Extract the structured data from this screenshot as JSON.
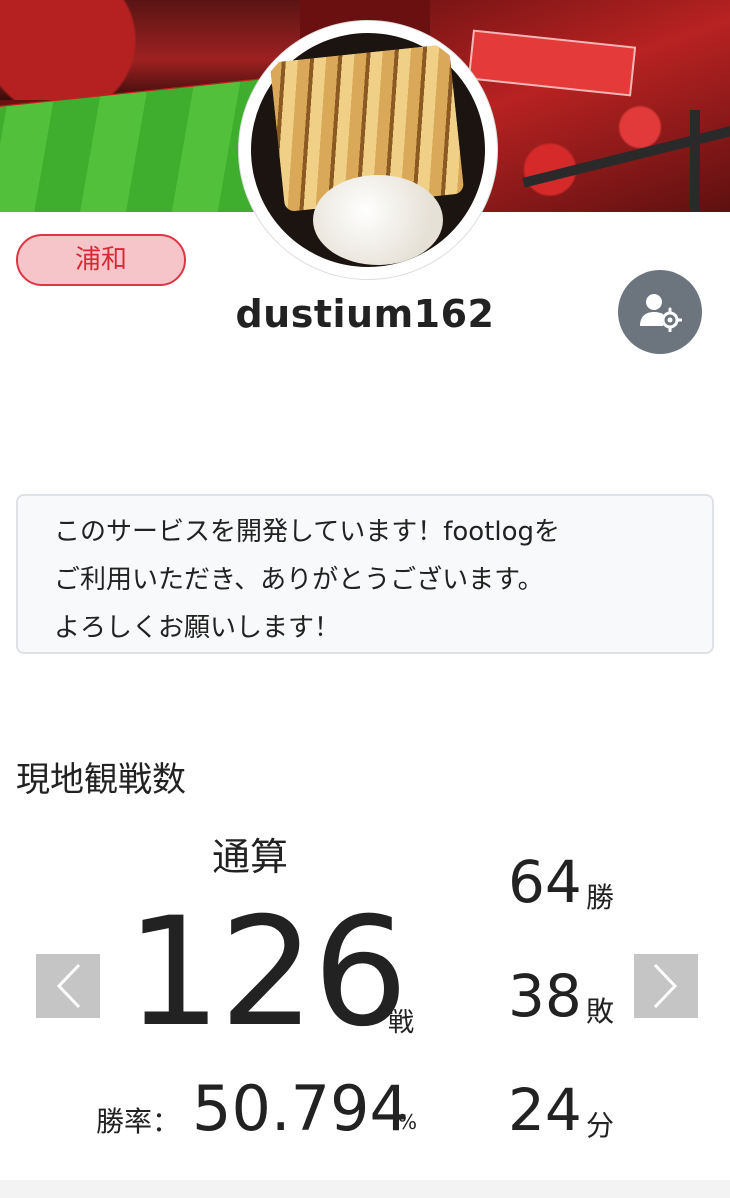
{
  "profile": {
    "team": "浦和",
    "username": "dustium162",
    "bio_lines": [
      "このサービスを開発しています！footlogを",
      "ご利用いただき、ありがとうございます。",
      "よろしくお願いします！"
    ]
  },
  "stats": {
    "section_title": "現地観戦数",
    "period": "通算",
    "total": "126",
    "total_unit": "戦",
    "win_rate_label": "勝率：",
    "win_rate": "50.794",
    "win_rate_unit": "%",
    "wins": "64",
    "wins_unit": "勝",
    "losses": "38",
    "losses_unit": "敗",
    "draws": "24",
    "draws_unit": "分"
  },
  "colors": {
    "team_badge_bg": "#f6c5ca",
    "team_badge_border": "#dc3545",
    "settings_button": "#6c757d",
    "nav_button": "#c5c5c5"
  },
  "icons": {
    "settings": "user-gear-icon",
    "prev": "chevron-left-icon",
    "next": "chevron-right-icon"
  }
}
